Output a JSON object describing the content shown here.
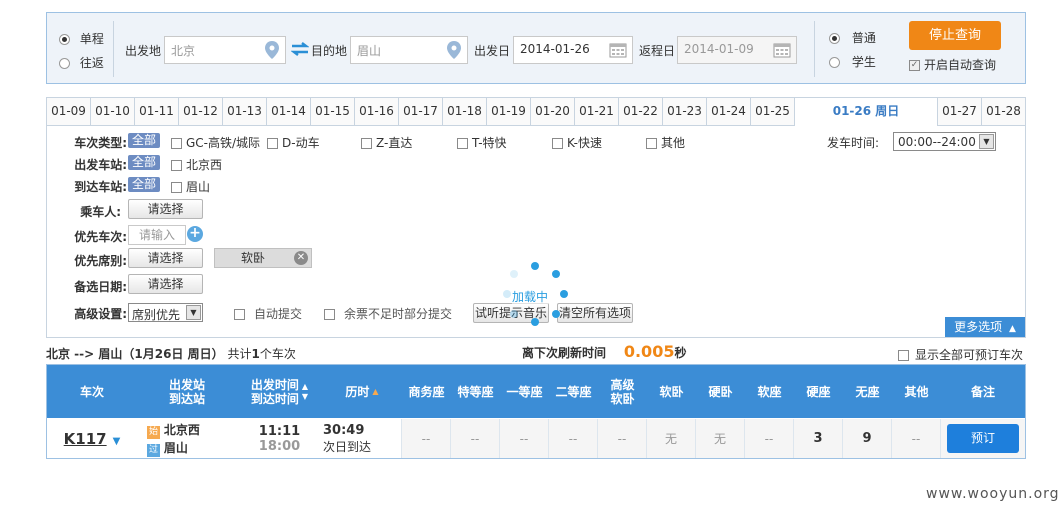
{
  "search": {
    "trip_types": [
      "单程",
      "往返"
    ],
    "from_label": "出发地",
    "from_value": "北京",
    "to_label": "目的地",
    "to_value": "眉山",
    "depart_label": "出发日",
    "depart_value": "2014-01-26",
    "return_label": "返程日",
    "return_value": "2014-01-09",
    "passenger_types": [
      "普通",
      "学生"
    ],
    "stop_button": "停止查询",
    "auto_query_label": "开启自动查询"
  },
  "date_tabs": [
    "01-09",
    "01-10",
    "01-11",
    "01-12",
    "01-13",
    "01-14",
    "01-15",
    "01-16",
    "01-17",
    "01-18",
    "01-19",
    "01-20",
    "01-21",
    "01-22",
    "01-23",
    "01-24",
    "01-25",
    "01-26 周日",
    "01-27",
    "01-28"
  ],
  "filters": {
    "train_type_label": "车次类型:",
    "all": "全部",
    "train_types": [
      "GC-高铁/城际",
      "D-动车",
      "Z-直达",
      "T-特快",
      "K-快速",
      "其他"
    ],
    "depart_time_label": "发车时间:",
    "depart_time_value": "00:00--24:00",
    "from_station_label": "出发车站:",
    "from_station": "北京西",
    "to_station_label": "到达车站:",
    "to_station": "眉山",
    "passenger_label": "乘车人:",
    "choose": "请选择",
    "priority_train_label": "优先车次:",
    "priority_train_placeholder": "请输入",
    "priority_seat_label": "优先席别:",
    "priority_seat_value": "软卧",
    "backup_date_label": "备选日期:",
    "advanced_label": "高级设置:",
    "advanced_value": "席别优先",
    "auto_submit": "自动提交",
    "partial_submit": "余票不足时部分提交",
    "test_music": "试听提示音乐",
    "clear_all": "清空所有选项",
    "more_options": "更多选项",
    "loading": "加载中"
  },
  "summary": {
    "route": "北京 --> 眉山（1月26日  周日）",
    "total_prefix": "共计",
    "count": "1",
    "total_suffix": "个车次",
    "refresh_label": "离下次刷新时间",
    "refresh_value": "0.005",
    "refresh_unit": "秒",
    "show_all": "显示全部可预订车次"
  },
  "table": {
    "headers": [
      "车次",
      "出发站\n到达站",
      "出发时间\n到达时间",
      "历时",
      "商务座",
      "特等座",
      "一等座",
      "二等座",
      "高级\n软卧",
      "软卧",
      "硬卧",
      "软座",
      "硬座",
      "无座",
      "其他",
      "备注"
    ],
    "row": {
      "train": "K117",
      "from_tag": "始",
      "from_station": "北京西",
      "to_tag": "过",
      "to_station": "眉山",
      "depart_time": "11:11",
      "arrive_time": "18:00",
      "duration": "30:49",
      "arrive_note": "次日到达",
      "seats": [
        "--",
        "--",
        "--",
        "--",
        "--",
        "无",
        "无",
        "--",
        "3",
        "9",
        "--"
      ],
      "book": "预订"
    }
  },
  "watermark": "www.wooyun.org"
}
